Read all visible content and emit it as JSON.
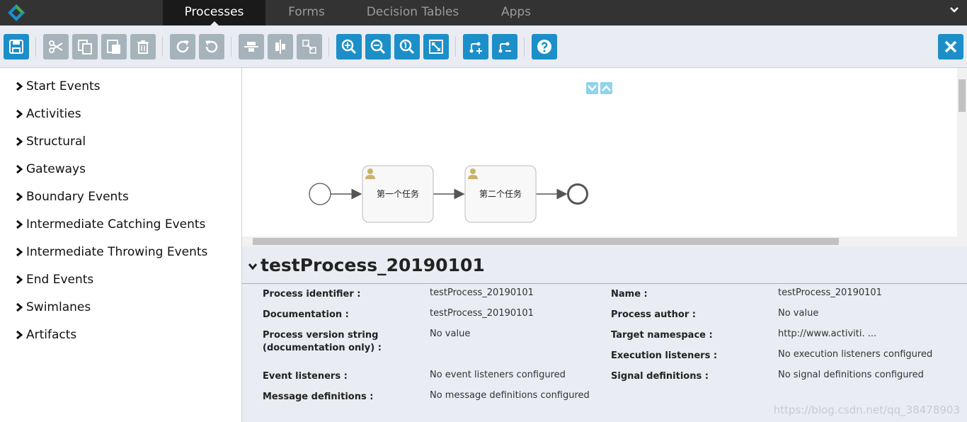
{
  "nav": {
    "tabs": [
      {
        "label": "Processes",
        "active": true
      },
      {
        "label": "Forms",
        "active": false
      },
      {
        "label": "Decision Tables",
        "active": false
      },
      {
        "label": "Apps",
        "active": false
      }
    ]
  },
  "toolbar": {
    "buttons": [
      "save",
      "cut",
      "copy",
      "paste",
      "delete",
      "redo",
      "undo",
      "align-horizontal",
      "align-vertical",
      "same-size",
      "zoom-in",
      "zoom-out",
      "zoom-actual",
      "zoom-fit",
      "add-bendpoint",
      "remove-bendpoint",
      "help",
      "close"
    ]
  },
  "palette": {
    "items": [
      "Start Events",
      "Activities",
      "Structural",
      "Gateways",
      "Boundary Events",
      "Intermediate Catching Events",
      "Intermediate Throwing Events",
      "End Events",
      "Swimlanes",
      "Artifacts"
    ]
  },
  "diagram": {
    "task1": "第一个任务",
    "task2": "第二个任务"
  },
  "properties": {
    "title": "testProcess_20190101",
    "left": [
      {
        "label": "Process identifier :",
        "value": "testProcess_20190101"
      },
      {
        "label": "Documentation :",
        "value": "testProcess_20190101"
      },
      {
        "label": "Process version string (documentation only) :",
        "value": "No value"
      },
      {
        "label": "Event listeners :",
        "value": "No event listeners configured"
      },
      {
        "label": "Message definitions :",
        "value": "No message definitions configured"
      }
    ],
    "right": [
      {
        "label": "Name :",
        "value": "testProcess_20190101"
      },
      {
        "label": "Process author :",
        "value": "No value"
      },
      {
        "label": "Target namespace :",
        "value": "http://www.activiti. ..."
      },
      {
        "label": "Execution listeners :",
        "value": "No execution listeners configured"
      },
      {
        "label": "Signal definitions :",
        "value": "No signal definitions configured"
      }
    ]
  },
  "watermark": "https://blog.csdn.net/qq_38478903",
  "colors": {
    "accent": "#1c8fc9",
    "toolbar_grey": "#a6b3ba",
    "nav_bg": "#333333"
  }
}
